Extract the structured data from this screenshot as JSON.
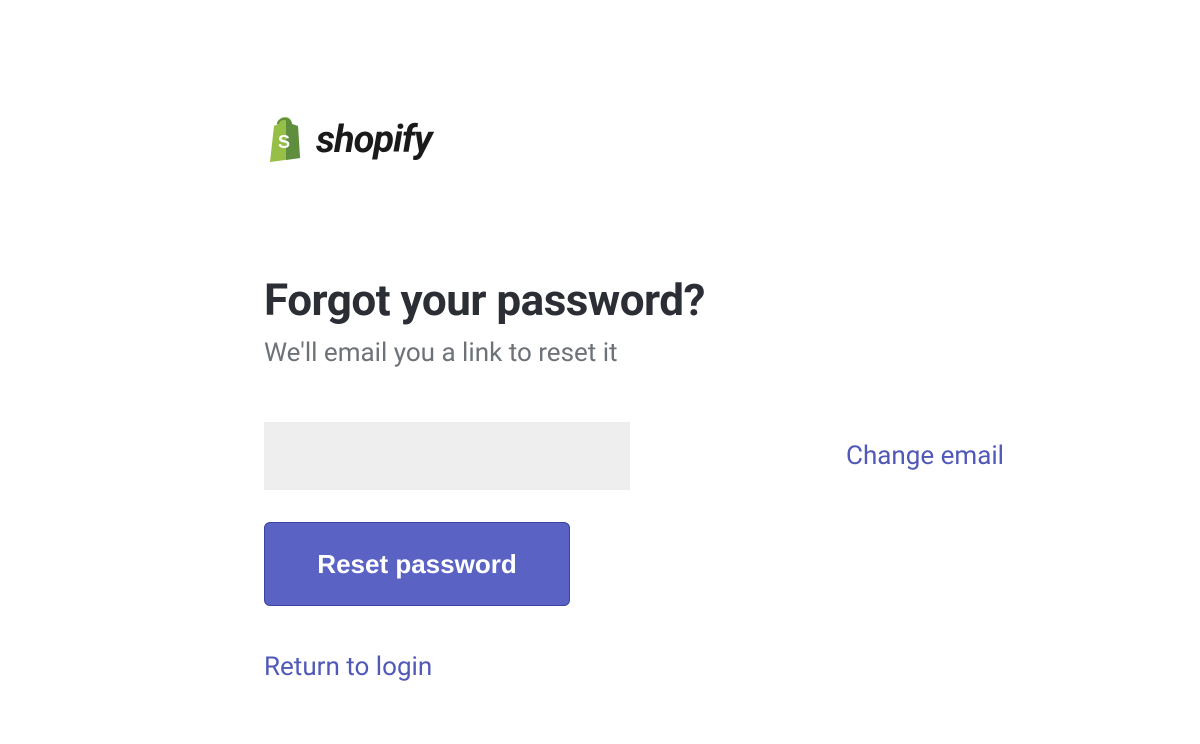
{
  "brand": {
    "name": "shopify"
  },
  "page": {
    "heading": "Forgot your password?",
    "subheading": "We'll email you a link to reset it"
  },
  "form": {
    "email_value": "",
    "change_email_label": "Change email",
    "reset_button_label": "Reset password",
    "return_link_label": "Return to login"
  },
  "colors": {
    "primary": "#5a62c4",
    "link": "#5058b8",
    "text_dark": "#2c2e36",
    "text_muted": "#6d7278",
    "input_bg": "#eeeeee"
  }
}
